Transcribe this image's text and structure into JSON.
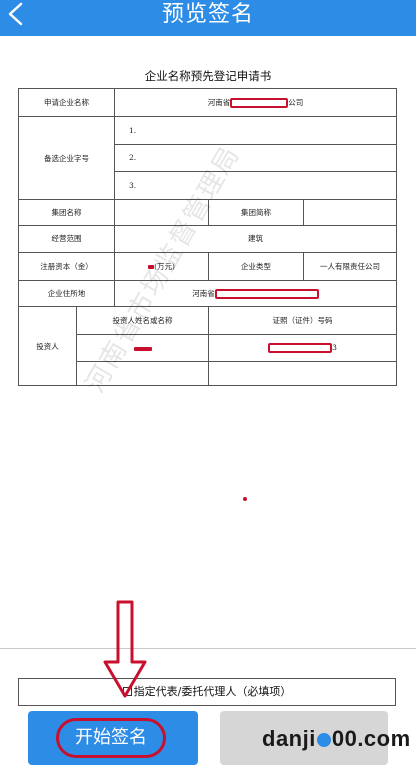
{
  "header": {
    "title": "预览签名",
    "back_icon": "chevron-left-icon",
    "bg_color": "#2d8ce6"
  },
  "document": {
    "title": "企业名称预先登记申请书",
    "rows": {
      "applicant_label": "申请企业名称",
      "applicant_prefix": "河南省",
      "applicant_suffix": "公司",
      "alt_names_label": "备选企业字号",
      "alt_name_1": "1.",
      "alt_name_2": "2.",
      "alt_name_3": "3.",
      "group_name_label": "集团名称",
      "group_short_label": "集团简称",
      "scope_label": "经营范围",
      "scope_value": "建筑",
      "capital_label": "注册资本（金）",
      "capital_value": "(万元)",
      "type_label": "企业类型",
      "type_value": "一人有限责任公司",
      "address_label": "企业住所地",
      "address_prefix": "河南省",
      "investor_label": "投资人",
      "investor_name_header": "投资人姓名或名称",
      "investor_id_header": "证照（证件）号码",
      "investor_id_suffix": "3"
    },
    "watermark": "河南省市场监督管理局"
  },
  "agent": {
    "label": "指定代表/委托代理人（必填项）"
  },
  "buttons": {
    "start_label": "开始签名",
    "primary_color": "#2d8ce6",
    "annotation_color": "#c8102e"
  },
  "site_logo": {
    "text_before": "danji",
    "text_after": "00.com",
    "ball_char": "1"
  }
}
